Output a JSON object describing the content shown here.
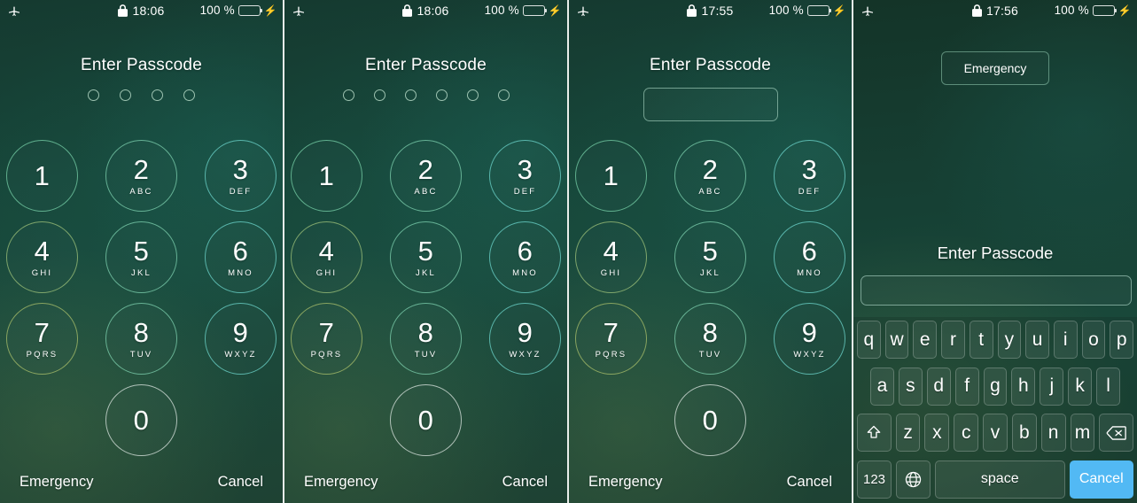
{
  "statusbar": {
    "airplane_icon": "airplane-icon",
    "lock_icon": "lock-icon",
    "battery_pct": "100 %",
    "charging_icon": "lightning-bolt-icon",
    "times": [
      "18:06",
      "18:06",
      "17:55",
      "17:56"
    ]
  },
  "labels": {
    "enter_passcode": "Enter Passcode",
    "emergency": "Emergency",
    "cancel": "Cancel"
  },
  "keypad": [
    {
      "num": "1",
      "letters": ""
    },
    {
      "num": "2",
      "letters": "ABC"
    },
    {
      "num": "3",
      "letters": "DEF"
    },
    {
      "num": "4",
      "letters": "GHI"
    },
    {
      "num": "5",
      "letters": "JKL"
    },
    {
      "num": "6",
      "letters": "MNO"
    },
    {
      "num": "7",
      "letters": "PQRS"
    },
    {
      "num": "8",
      "letters": "TUV"
    },
    {
      "num": "9",
      "letters": "WXYZ"
    },
    {
      "num": "0",
      "letters": ""
    }
  ],
  "panels": [
    {
      "id": "panel-4-dot-passcode",
      "dot_count": 4,
      "time": "18:06"
    },
    {
      "id": "panel-6-dot-passcode",
      "dot_count": 6,
      "time": "18:06"
    },
    {
      "id": "panel-field-passcode",
      "time": "17:55"
    },
    {
      "id": "panel-keyboard-passcode",
      "time": "17:56"
    }
  ],
  "keyboard": {
    "row1": [
      "q",
      "w",
      "e",
      "r",
      "t",
      "y",
      "u",
      "i",
      "o",
      "p"
    ],
    "row2": [
      "a",
      "s",
      "d",
      "f",
      "g",
      "h",
      "j",
      "k",
      "l"
    ],
    "row3_letters": [
      "z",
      "x",
      "c",
      "v",
      "b",
      "n",
      "m"
    ],
    "shift_icon": "shift-icon",
    "backspace_icon": "backspace-icon",
    "numeric_label": "123",
    "globe_icon": "globe-icon",
    "space_label": "space",
    "cancel_label": "Cancel",
    "input_value": ""
  },
  "colors": {
    "accent_blue": "#52b9f4",
    "battery_green": "#4cd964",
    "background_green": "#17473a"
  }
}
